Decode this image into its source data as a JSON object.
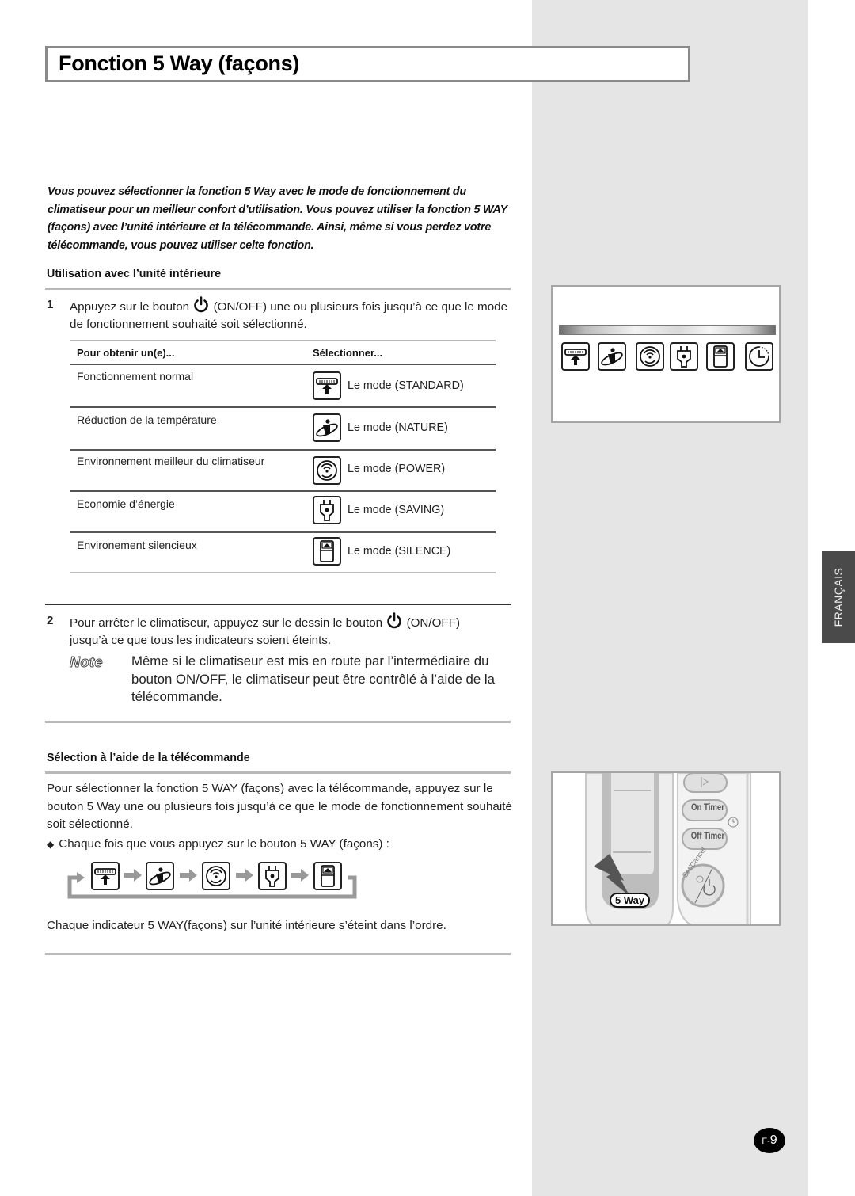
{
  "page": {
    "title": "Fonction 5 Way (façons)",
    "language_tab": "FRANÇAIS",
    "page_number_prefix": "F-",
    "page_number": "9"
  },
  "intro": "Vous pouvez sélectionner la fonction 5 Way avec le mode de fonctionnement du climatiseur pour un meilleur confort d’utilisation. Vous pouvez utiliser la fonction 5 WAY (façons) avec l’unité intérieure et la télécommande. Ainsi, même si vous perdez votre télécommande, vous pouvez utiliser celte fonction.",
  "section_indoor": {
    "heading": "Utilisation avec l’unité intérieure",
    "step1": {
      "num": "1",
      "before_icon": "Appuyez sur le bouton",
      "icon": "power-icon",
      "after_icon": "(ON/OFF) une ou plusieurs fois jusqu’à ce que le mode de fonctionnement souhaité soit sélectionné."
    },
    "table": {
      "headers": [
        "Pour obtenir un(e)...",
        "Sélectionner..."
      ],
      "rows": [
        {
          "purpose": "Fonctionnement normal",
          "icon": "standard-mode-icon",
          "mode": "Le mode (STANDARD)"
        },
        {
          "purpose": "Réduction de la température",
          "icon": "nature-mode-icon",
          "mode": "Le mode (NATURE)"
        },
        {
          "purpose": "Environnement meilleur du climatiseur",
          "icon": "power-mode-icon",
          "mode": "Le mode (POWER)"
        },
        {
          "purpose": "Economie d’énergie",
          "icon": "saving-mode-icon",
          "mode": "Le mode (SAVING)"
        },
        {
          "purpose": "Environement silencieux",
          "icon": "silence-mode-icon",
          "mode": "Le mode (SILENCE)"
        }
      ]
    },
    "step2": {
      "num": "2",
      "before_icon": "Pour arrêter le climatiseur, appuyez sur le dessin le bouton",
      "icon": "power-icon",
      "after_icon": "(ON/OFF)",
      "line2": "jusqu’à ce que tous les indicateurs soient éteints."
    },
    "note": {
      "label": "Note",
      "text": "Même si le climatiseur est mis en route par l’intermédiaire du bouton ON/OFF, le climatiseur peut être contrôlé à l’aide de la télécommande."
    }
  },
  "section_remote": {
    "heading": "Sélection à l’aide de la télécommande",
    "paragraph": "Pour sélectionner la fonction 5 WAY (façons) avec la télécommande, appuyez sur le bouton 5 Way une ou plusieurs fois jusqu’à ce que le mode de fonctionnement souhaité soit sélectionné.",
    "bullet": "Chaque fois que vous appuyez sur le bouton 5 WAY (façons) :",
    "cycle_icons": [
      "standard-mode-icon",
      "nature-mode-icon",
      "power-mode-icon",
      "saving-mode-icon",
      "silence-mode-icon"
    ],
    "footer": "Chaque indicateur 5 WAY(façons) sur l’unité intérieure s’éteint dans l’ordre."
  },
  "indoor_panel": {
    "indicators": [
      "standard-mode-icon",
      "nature-mode-icon",
      "power-mode-icon",
      "saving-mode-icon",
      "silence-mode-icon",
      "timer-icon"
    ]
  },
  "remote": {
    "buttons": {
      "swing": "",
      "on_timer": "On Timer",
      "off_timer": "Off Timer",
      "set_cancel": "Set/Cancel",
      "five_way": "5 Way"
    }
  }
}
